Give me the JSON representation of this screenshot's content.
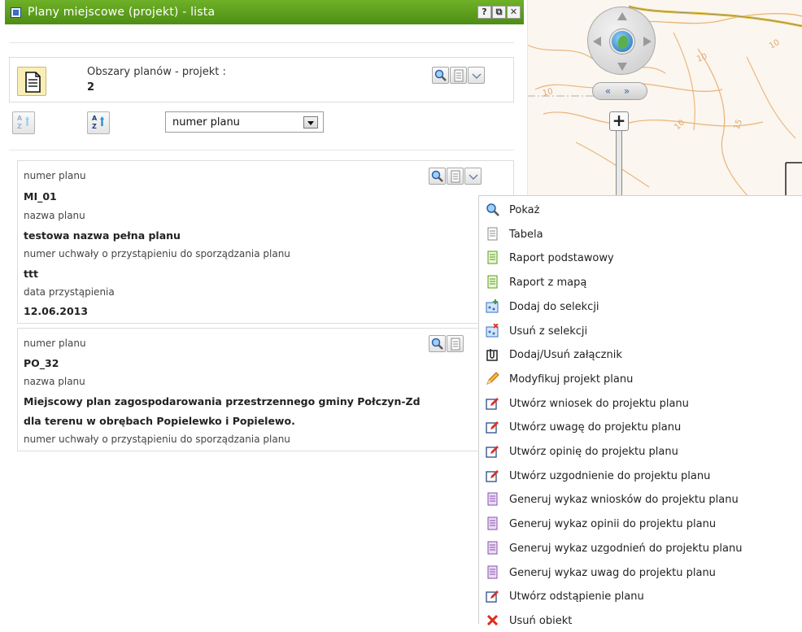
{
  "window": {
    "title": "Plany miejscowe (projekt) - lista",
    "help_btn": "?",
    "restore_btn": "⧉",
    "close_btn": "✕"
  },
  "summary": {
    "label": "Obszary planów - projekt :",
    "count": "2"
  },
  "sort": {
    "selected": "numer planu"
  },
  "map": {
    "scroll_label": "« »",
    "zoom_in": "+"
  },
  "records": [
    {
      "fields": [
        {
          "label": "numer planu",
          "value": "MI_01"
        },
        {
          "label": "nazwa planu",
          "value": "testowa nazwa pełna planu"
        },
        {
          "label": "numer uchwały o przystąpieniu do sporządzania planu",
          "value": "ttt"
        },
        {
          "label": "data przystąpienia",
          "value": "12.06.2013"
        }
      ]
    },
    {
      "fields": [
        {
          "label": "numer planu",
          "value": "PO_32"
        },
        {
          "label": "nazwa planu",
          "value": "Miejscowy plan zagospodarowania przestrzennego gminy Połczyn-Zd",
          "value_line2": "dla terenu w obrębach Popielewko i Popielewo."
        },
        {
          "label": "numer uchwały o przystąpieniu do sporządzania planu"
        }
      ]
    }
  ],
  "context_menu": [
    {
      "label": "Pokaż",
      "icon": "magnifier-icon"
    },
    {
      "label": "Tabela",
      "icon": "table-doc-icon"
    },
    {
      "label": "Raport podstawowy",
      "icon": "report-icon"
    },
    {
      "label": "Raport z mapą",
      "icon": "report-map-icon"
    },
    {
      "label": "Dodaj do selekcji",
      "icon": "add-selection-icon"
    },
    {
      "label": "Usuń z selekcji",
      "icon": "remove-selection-icon"
    },
    {
      "label": "Dodaj/Usuń załącznik",
      "icon": "attachment-icon"
    },
    {
      "label": "Modyfikuj projekt planu",
      "icon": "pencil-icon"
    },
    {
      "label": "Utwórz wniosek do projektu planu",
      "icon": "edit-form-icon"
    },
    {
      "label": "Utwórz uwagę do projektu planu",
      "icon": "edit-form-icon"
    },
    {
      "label": "Utwórz opinię do projektu planu",
      "icon": "edit-form-icon"
    },
    {
      "label": "Utwórz uzgodnienie do projektu planu",
      "icon": "edit-form-icon"
    },
    {
      "label": "Generuj wykaz wniosków do projektu planu",
      "icon": "list-doc-icon"
    },
    {
      "label": "Generuj wykaz opinii do projektu planu",
      "icon": "list-doc-icon"
    },
    {
      "label": "Generuj wykaz uzgodnień do projektu planu",
      "icon": "list-doc-icon"
    },
    {
      "label": "Generuj wykaz uwag do projektu planu",
      "icon": "list-doc-icon"
    },
    {
      "label": "Utwórz odstąpienie planu",
      "icon": "edit-form-icon"
    },
    {
      "label": "Usuń obiekt",
      "icon": "delete-x-icon"
    }
  ],
  "colors": {
    "title_green": "#5a9b1c",
    "accent_blue": "#3c6fc2"
  }
}
